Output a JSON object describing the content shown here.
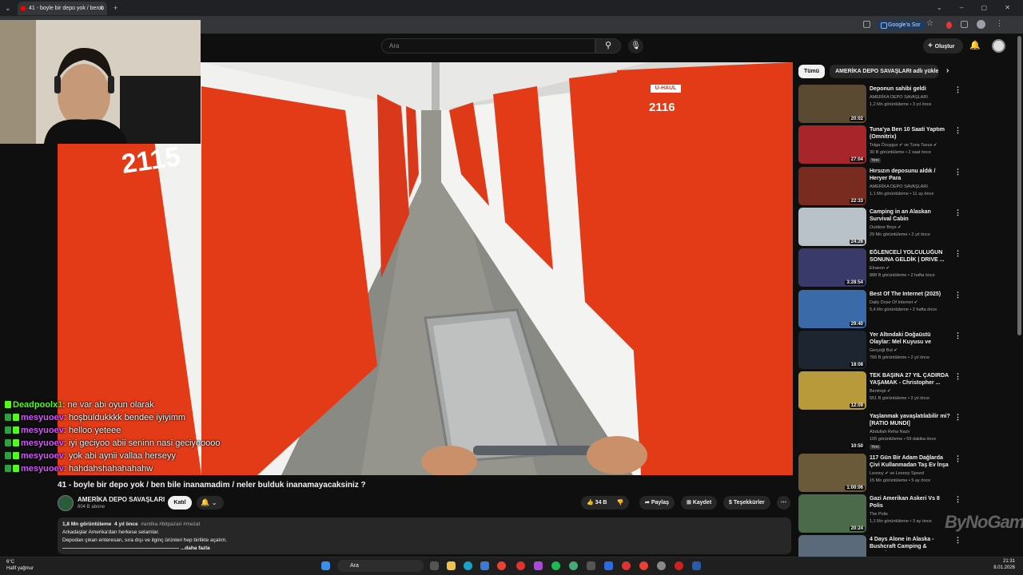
{
  "browser": {
    "tab_title": "41 - boyle bir depo yok / ben b",
    "new_tab": "+",
    "google_sor": "Google'a Sor"
  },
  "header": {
    "search_placeholder": "Ara",
    "create_label": "Oluştur"
  },
  "video": {
    "locker_left": "2115",
    "locker_right": "2116",
    "locker_brand": "U-HAUL"
  },
  "chat": [
    {
      "user": "Deadpoolx1",
      "msg": "ne var abi oyun olarak"
    },
    {
      "user": "mesyuoev",
      "msg": "hoşbuldukkkk bendee iyiyimm"
    },
    {
      "user": "mesyuoev",
      "msg": "helloo yeteee"
    },
    {
      "user": "mesyuoev",
      "msg": "iyi geciyoo abii seninn nasi geciyooooo"
    },
    {
      "user": "mesyuoev",
      "msg": "yok abi aynii vallaa herseyy"
    },
    {
      "user": "mesyuoev",
      "msg": "hahdahshahahahahw"
    }
  ],
  "watch": {
    "title": "41 - boyle bir depo yok / ben bile inanamadim / neler bulduk inanamayacaksiniz ?",
    "channel": "AMERİKA DEPO SAVAŞLARI",
    "subs": "604 B abone",
    "join": "Katıl",
    "likes": "34 B",
    "share": "Paylaş",
    "save": "Kaydet",
    "thanks": "Teşekkürler",
    "views": "1,8 Mn görüntüleme",
    "age": "4 yıl önce",
    "tags": "#antika #bitpazari #mezat",
    "desc1": "Arkadaşlar Amerika'dan herkese selamlar.",
    "desc2": "Depodan çıkan enteresan, sıra dışı ve ilginç ürünleri hep birlikte açalım.",
    "more": "...daha fazla"
  },
  "sidebar": {
    "chips": [
      "Tümü",
      "AMERİKA DEPO SAVAŞLARI adlı yükleyiciden"
    ],
    "recs": [
      {
        "title": "Deponun sahibi geldi",
        "channel": "AMERİKA DEPO SAVAŞLARI",
        "meta": "1,2 Mn görüntüleme • 3 yıl önce",
        "dur": "20:02",
        "color": "#5a4a32"
      },
      {
        "title": "Tuna'ya Ben 10 Saati Yaptım (Omnitrix)",
        "channel": "Tolga Özuygur ✔ ve Tuna Tavus ✔",
        "meta": "30 B görüntüleme • 2 saat önce",
        "dur": "27:04",
        "color": "#a8262a",
        "badge": "Yeni"
      },
      {
        "title": "Hırsızın deposunu aldık / Heryer Para",
        "channel": "AMERİKA DEPO SAVAŞLARI",
        "meta": "1,1 Mn görüntüleme • 11 ay önce",
        "dur": "22:33",
        "color": "#7a2b1f"
      },
      {
        "title": "Camping in an Alaskan Survival Cabin",
        "channel": "Outdoor Boys ✔",
        "meta": "29 Mn görüntüleme • 2 yıl önce",
        "dur": "24:26",
        "color": "#b9c2c8"
      },
      {
        "title": "EĞLENCELİ YOLCULUĞUN SONUNA GELDİK | DRIVE ...",
        "channel": "Elraenn ✔",
        "meta": "888 B görüntüleme • 2 hafta önce",
        "dur": "3:28:54",
        "color": "#3a3a6a"
      },
      {
        "title": "Best Of The Internet (2025)",
        "channel": "Daily Dose Of Internet ✔",
        "meta": "5,4 Mn görüntüleme • 2 hafta önce",
        "dur": "29:40",
        "color": "#3a6aa8"
      },
      {
        "title": "Yer Altındaki Doğaüstü Olaylar: Mel Kuyusu ve Açıklanamayan...",
        "channel": "Gerçeği Bul ✔",
        "meta": "766 B görüntüleme • 2 yıl önce",
        "dur": "18:08",
        "color": "#1c2530"
      },
      {
        "title": "TEK BAŞINA 27 YIL ÇADIRDA YAŞAMAK - Christopher ...",
        "channel": "Bentropi ✔",
        "meta": "551 B görüntüleme • 2 yıl önce",
        "dur": "12:09",
        "color": "#b89a3a"
      },
      {
        "title": "Yaşlanmak yavaşlatılabilir mi? [RATIO MUNDI]",
        "channel": "Abdullah Reha Nazlı",
        "meta": "105 görüntüleme • 59 dakika önce",
        "dur": "10:50",
        "color": "#111111",
        "badge": "Yeni"
      },
      {
        "title": "117 Gün Bir Adam Dağlarda Çivi Kullanmadan Taş Ev İnşa Etti",
        "channel": "Lesnoy ✔ ve Lesnoy Speed",
        "meta": "15 Mn görüntüleme • 5 ay önce",
        "dur": "1:00:06",
        "color": "#6a5a3a"
      },
      {
        "title": "Gazi Amerikan Askeri Vs 8 Polis",
        "channel": "The Polis",
        "meta": "1,1 Mn görüntüleme • 3 ay önce",
        "dur": "20:24",
        "color": "#4a6a4a"
      },
      {
        "title": "4 Days Alone in Alaska - Bushcraft Camping & Foraging...",
        "channel": "",
        "meta": "",
        "dur": "",
        "color": "#5a6a7a"
      }
    ]
  },
  "watermark": "ByNoGame",
  "taskbar": {
    "temp": "6°C",
    "weather": "Hafif yağmur",
    "search": "Ara",
    "time": "21:31",
    "date": "8.01.2026"
  },
  "colors": {
    "locker_red": "#e33a17",
    "kick_green": "#53fc18",
    "yt_bg": "#0f0f0f"
  }
}
